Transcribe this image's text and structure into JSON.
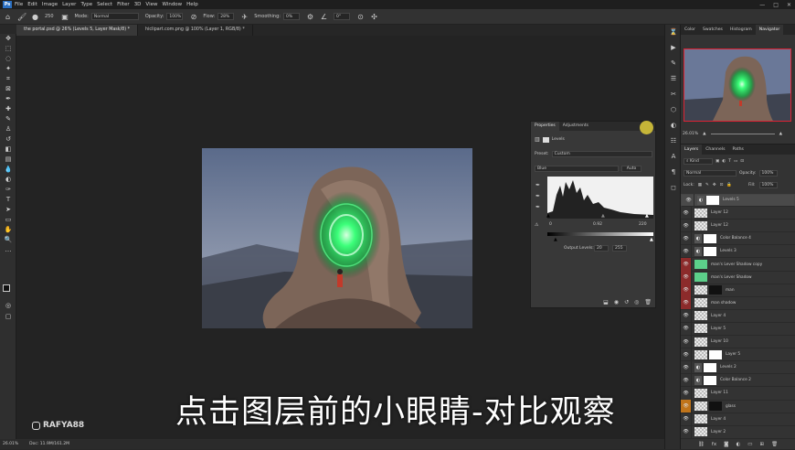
{
  "menu": [
    "File",
    "Edit",
    "Image",
    "Layer",
    "Type",
    "Select",
    "Filter",
    "3D",
    "View",
    "Window",
    "Help"
  ],
  "window_controls": {
    "minimize": "—",
    "maximize": "□",
    "close": "✕"
  },
  "options_bar": {
    "mode_label": "Mode:",
    "mode_value": "Normal",
    "opacity_label": "Opacity:",
    "opacity_value": "100%",
    "flow_label": "Flow:",
    "flow_value": "28%",
    "smoothing_label": "Smoothing:",
    "smoothing_value": "0%",
    "angle_value": "0°",
    "brush_size": "250"
  },
  "doc_tabs": [
    {
      "label": "the portal.psd @ 26% (Levels 5, Layer Mask/8) *"
    },
    {
      "label": "hiclipart.com.png @ 100% (Layer 1, RGB/8) *"
    }
  ],
  "status": {
    "zoom": "26.01%",
    "doc": "Doc: 11.9M/161.2M"
  },
  "subtitle": "点击图层前的小眼睛-对比观察",
  "watermark": "RAFYA88",
  "properties": {
    "tab_properties": "Properties",
    "tab_adjustments": "Adjustments",
    "levels_label": "Levels",
    "preset_label": "Preset:",
    "preset_value": "Custom",
    "channel_value": "Blue",
    "auto_label": "Auto",
    "input_black": "0",
    "input_mid": "0.92",
    "input_white": "220",
    "output_label": "Output Levels:",
    "output_black": "20",
    "output_white": "255"
  },
  "navigator": {
    "tabs": [
      "Color",
      "Swatches",
      "Histogram",
      "Navigator"
    ],
    "zoom": "26.01%"
  },
  "layers_panel": {
    "tabs": [
      "Layers",
      "Channels",
      "Paths"
    ],
    "kind_label": "Kind",
    "blend_value": "Normal",
    "opacity_label": "Opacity:",
    "opacity_value": "100%",
    "lock_label": "Lock:",
    "fill_label": "Fill:",
    "fill_value": "100%",
    "layers": [
      {
        "name": "Levels 5",
        "type": "adj",
        "eye": "normal",
        "mask": "white",
        "selected": true
      },
      {
        "name": "Layer 12",
        "type": "pixel",
        "eye": "normal"
      },
      {
        "name": "Layer 12",
        "type": "pixel",
        "eye": "normal"
      },
      {
        "name": "Color Balance 4",
        "type": "adj",
        "eye": "normal",
        "mask": "white"
      },
      {
        "name": "Levels 3",
        "type": "adj",
        "eye": "normal",
        "mask": "white"
      },
      {
        "name": "man's Lever Shadow copy",
        "type": "green",
        "eye": "red"
      },
      {
        "name": "man's Lever Shadow",
        "type": "green",
        "eye": "red"
      },
      {
        "name": "man",
        "type": "pixel",
        "eye": "red",
        "mask": "black"
      },
      {
        "name": "man shadow",
        "type": "pixel",
        "eye": "red"
      },
      {
        "name": "Layer 4",
        "type": "pixel",
        "eye": "normal"
      },
      {
        "name": "Layer 5",
        "type": "pixel",
        "eye": "normal"
      },
      {
        "name": "Layer 10",
        "type": "pixel",
        "eye": "normal"
      },
      {
        "name": "Layer 5",
        "type": "pixel",
        "eye": "normal",
        "mask": "white"
      },
      {
        "name": "Levels 2",
        "type": "adj",
        "eye": "normal",
        "mask": "white"
      },
      {
        "name": "Color Balance 2",
        "type": "adj",
        "eye": "normal",
        "mask": "white"
      },
      {
        "name": "Layer 11",
        "type": "pixel",
        "eye": "normal"
      },
      {
        "name": "glass",
        "type": "pixel",
        "eye": "orange",
        "mask": "black"
      },
      {
        "name": "Layer 4",
        "type": "pixel",
        "eye": "normal"
      },
      {
        "name": "Layer 2",
        "type": "pixel",
        "eye": "normal"
      }
    ]
  },
  "colors": {
    "accent": "#2b6fc0",
    "portal_green": "#3cff7a",
    "selected_eye": "#8c2b2b"
  }
}
